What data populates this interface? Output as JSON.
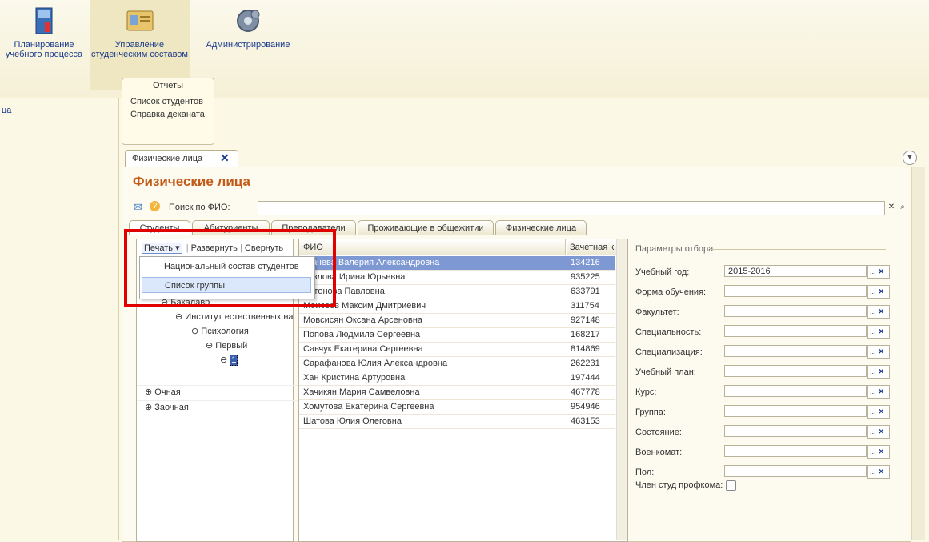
{
  "sections": [
    {
      "label_line1": "Планирование",
      "label_line2": "учебного процесса",
      "icon": "book-icon"
    },
    {
      "label_line1": "Управление",
      "label_line2": "студенческим составом",
      "icon": "id-card-icon"
    },
    {
      "label_line1": "Администрирование",
      "label_line2": "",
      "icon": "gears-icon"
    }
  ],
  "leftnav_fragment": "ца",
  "reports": {
    "header": "Отчеты",
    "items": [
      "Список студентов",
      "Справка деканата"
    ]
  },
  "window_tab": {
    "label": "Физические лица",
    "close": "✕"
  },
  "page": {
    "title": "Физические лица",
    "search_label": "Поиск по ФИО:",
    "search_value": ""
  },
  "subtabs": [
    "Студенты",
    "Абитуриенты",
    "Преподаватели",
    "Проживающие в общежитии",
    "Физические лица"
  ],
  "tree_toolbar": {
    "print": "Печать",
    "expand": "Развернуть",
    "collapse": "Свернуть"
  },
  "dropdown": {
    "items": [
      "Национальный состав студентов",
      "Список группы"
    ]
  },
  "tree": [
    {
      "label": "Бакалавр",
      "level": 1,
      "glyph": "⊖"
    },
    {
      "label": "Институт естественных на",
      "level": 2,
      "glyph": "⊖"
    },
    {
      "label": "Психология",
      "level": 3,
      "glyph": "⊖"
    },
    {
      "label": "Первый",
      "level": 4,
      "glyph": "⊖"
    },
    {
      "label": "1",
      "level": 5,
      "glyph": "⊖"
    },
    {
      "label": "Очная",
      "level": 0,
      "glyph": "⊕"
    },
    {
      "label": "Заочная",
      "level": 0,
      "glyph": "⊕"
    }
  ],
  "list": {
    "col_fio": "ФИО",
    "col_num": "Зачетная к",
    "rows": [
      {
        "fio": "Ткачева Валерия Александровна",
        "num": "134216"
      },
      {
        "fio": "Козлова Ирина Юрьевна",
        "num": "935225"
      },
      {
        "fio": "Антонова Павловна",
        "num": "633791"
      },
      {
        "fio": "Моисеев Максим Дмитриевич",
        "num": "311754"
      },
      {
        "fio": "Мовсисян Оксана Арсеновна",
        "num": "927148"
      },
      {
        "fio": "Попова Людмила Сергеевна",
        "num": "168217"
      },
      {
        "fio": "Савчук Екатерина Сергеевна",
        "num": "814869"
      },
      {
        "fio": "Сарафанова Юлия Александровна",
        "num": "262231"
      },
      {
        "fio": "Хан Кристина Артуровна",
        "num": "197444"
      },
      {
        "fio": "Хачикян Мария Самвеловна",
        "num": "467778"
      },
      {
        "fio": "Хомутова Екатерина Сергеевна",
        "num": "954946"
      },
      {
        "fio": "Шатова Юлия Олеговна",
        "num": "463153"
      }
    ]
  },
  "params": {
    "header": "Параметры отбора",
    "fields": [
      {
        "label": "Учебный год:",
        "value": "2015-2016"
      },
      {
        "label": "Форма обучения:",
        "value": ""
      },
      {
        "label": "Факультет:",
        "value": ""
      },
      {
        "label": "Специальность:",
        "value": ""
      },
      {
        "label": "Специализация:",
        "value": ""
      },
      {
        "label": "Учебный план:",
        "value": ""
      },
      {
        "label": "Курс:",
        "value": ""
      },
      {
        "label": "Группа:",
        "value": ""
      },
      {
        "label": "Состояние:",
        "value": ""
      },
      {
        "label": "Военкомат:",
        "value": ""
      },
      {
        "label": "Пол:",
        "value": ""
      }
    ],
    "checkbox_label": "Член студ профкома:"
  },
  "colors": {
    "title": "#c25a18",
    "selected_row": "#7d98d3",
    "highlight_box": "#e00000"
  }
}
